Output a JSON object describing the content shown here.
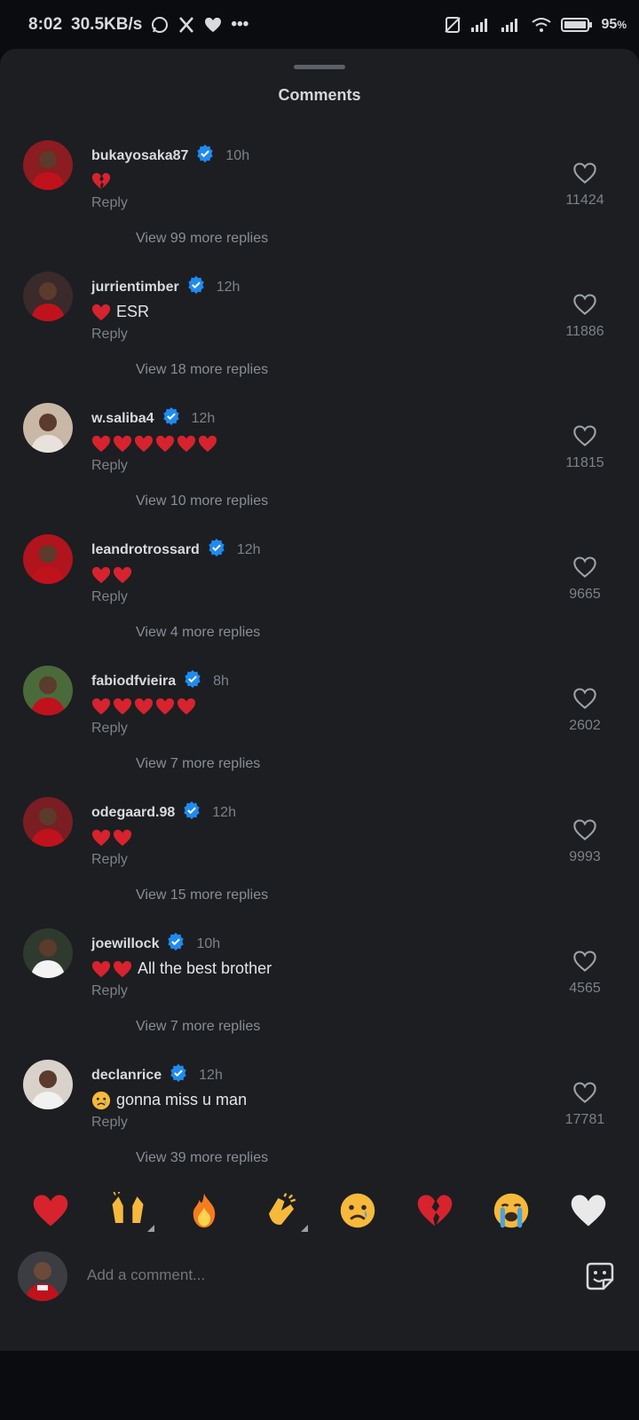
{
  "status_bar": {
    "time": "8:02",
    "net_speed": "30.5KB/s",
    "more": "•••",
    "battery": "95",
    "battery_suffix": "%"
  },
  "sheet": {
    "title": "Comments"
  },
  "comments": [
    {
      "user": "bukayosaka87",
      "time": "10h",
      "text": "",
      "emojis": [
        "broken-heart"
      ],
      "reply": "Reply",
      "more": "View 99 more replies",
      "likes": "11424",
      "avatar_color": "#8b1c1f"
    },
    {
      "user": "jurrientimber",
      "time": "12h",
      "text": "ESR",
      "emojis": [
        "red-heart"
      ],
      "reply": "Reply",
      "more": "View 18 more replies",
      "likes": "11886",
      "avatar_color": "#3a2a2a"
    },
    {
      "user": "w.saliba4",
      "time": "12h",
      "text": "",
      "emojis": [
        "red-heart",
        "red-heart",
        "red-heart",
        "red-heart",
        "red-heart",
        "red-heart"
      ],
      "reply": "Reply",
      "more": "View 10 more replies",
      "likes": "11815",
      "avatar_color": "#c9b8a6"
    },
    {
      "user": "leandrotrossard",
      "time": "12h",
      "text": "",
      "emojis": [
        "red-heart",
        "red-heart"
      ],
      "reply": "Reply",
      "more": "View 4 more replies",
      "likes": "9665",
      "avatar_color": "#b0141c"
    },
    {
      "user": "fabiodfvieira",
      "time": "8h",
      "text": "",
      "emojis": [
        "red-heart",
        "red-heart",
        "red-heart",
        "red-heart",
        "red-heart"
      ],
      "reply": "Reply",
      "more": "View 7 more replies",
      "likes": "2602",
      "avatar_color": "#4a6a3a"
    },
    {
      "user": "odegaard.98",
      "time": "12h",
      "text": "",
      "emojis": [
        "red-heart",
        "red-heart"
      ],
      "reply": "Reply",
      "more": "View 15 more replies",
      "likes": "9993",
      "avatar_color": "#7a1e24"
    },
    {
      "user": "joewillock",
      "time": "10h",
      "text": "All the best brother",
      "emojis": [
        "red-heart",
        "red-heart"
      ],
      "reply": "Reply",
      "more": "View 7 more replies",
      "likes": "4565",
      "avatar_color": "#2e3a2e"
    },
    {
      "user": "declanrice",
      "time": "12h",
      "text": "gonna miss u man",
      "emojis": [
        "sad-face"
      ],
      "reply": "Reply",
      "more": "View 39 more replies",
      "likes": "17781",
      "avatar_color": "#d9d2ca"
    }
  ],
  "emoji_bar": [
    "red-heart",
    "raising-hands",
    "fire",
    "clapping-hands",
    "sad-face",
    "broken-heart",
    "crying-face",
    "white-heart"
  ],
  "compose": {
    "placeholder": "Add a comment..."
  },
  "colors": {
    "verified": "#1f8bf0",
    "red_heart": "#d6232e",
    "background": "#1c1e22"
  }
}
